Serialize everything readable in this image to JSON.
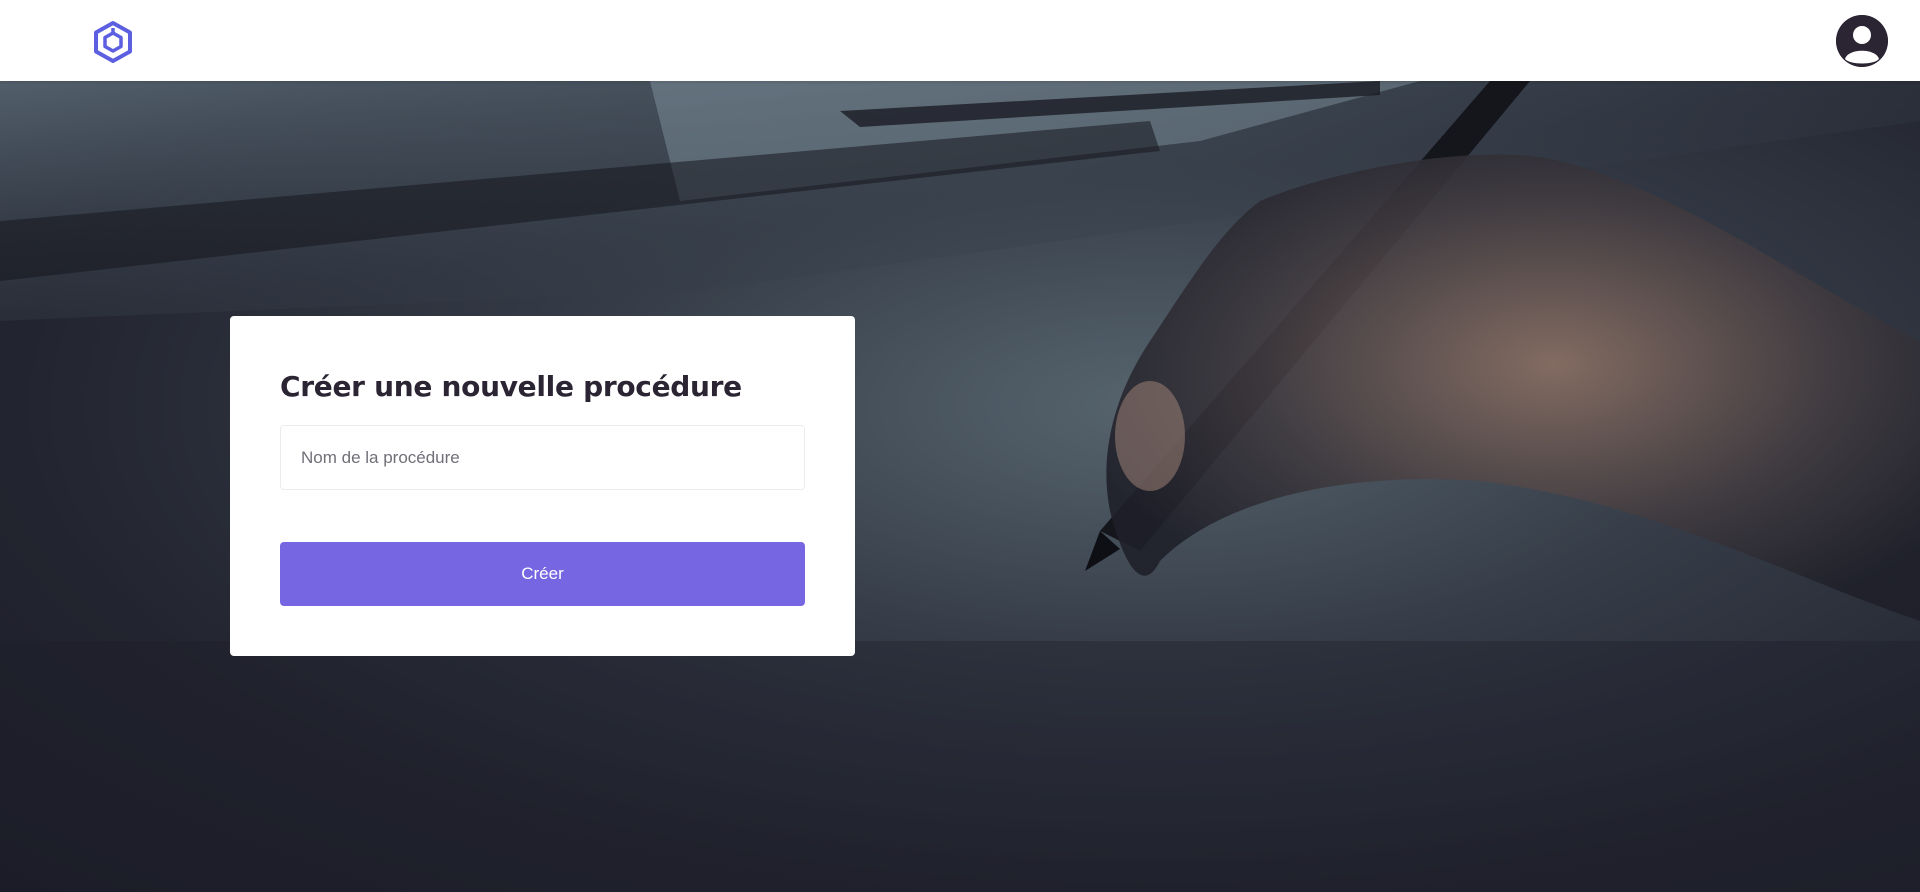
{
  "header": {
    "logo_icon": "hexagon-cube-logo-icon",
    "avatar_icon": "user-avatar-icon"
  },
  "form": {
    "title": "Créer une nouvelle procédure",
    "name_placeholder": "Nom de la procédure",
    "name_value": "",
    "submit_label": "Créer"
  },
  "colors": {
    "accent": "#7766e1",
    "logo": "#5b5fe0",
    "avatar_bg": "#2b2433"
  }
}
